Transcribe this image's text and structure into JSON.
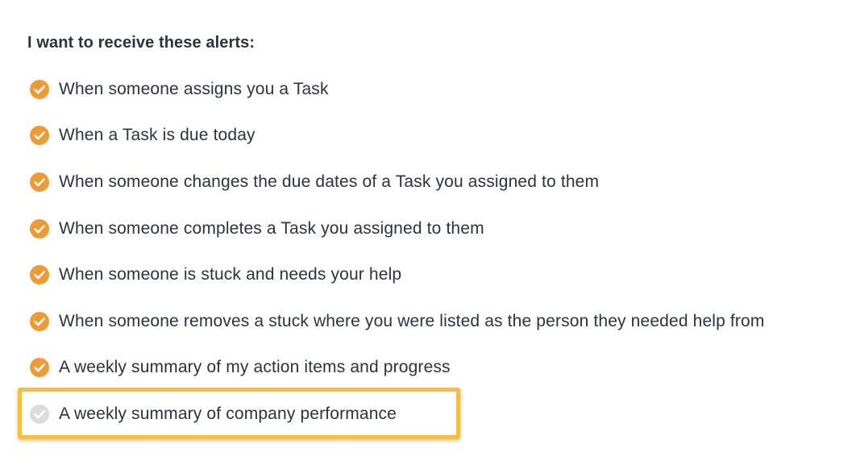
{
  "heading": "I want to receive these alerts:",
  "colors": {
    "checked": "#ef9a34",
    "unchecked": "#dcdcdc",
    "highlight_border": "#f6be3c",
    "text": "#2b3340"
  },
  "alerts": [
    {
      "label": "When someone assigns you a Task",
      "checked": true,
      "icon": "check-circle-icon"
    },
    {
      "label": "When a Task is due today",
      "checked": true,
      "icon": "check-circle-icon"
    },
    {
      "label": "When someone changes the due dates of a Task you assigned to them",
      "checked": true,
      "icon": "check-circle-icon"
    },
    {
      "label": "When someone completes a Task you assigned to them",
      "checked": true,
      "icon": "check-circle-icon"
    },
    {
      "label": "When someone is stuck and needs your help",
      "checked": true,
      "icon": "check-circle-icon"
    },
    {
      "label": "When someone removes a stuck where you were listed as the person they needed help from",
      "checked": true,
      "icon": "check-circle-icon"
    },
    {
      "label": "A weekly summary of my action items and progress",
      "checked": true,
      "icon": "check-circle-icon"
    },
    {
      "label": "A weekly summary of company performance",
      "checked": false,
      "icon": "check-circle-icon",
      "highlighted": true
    }
  ]
}
